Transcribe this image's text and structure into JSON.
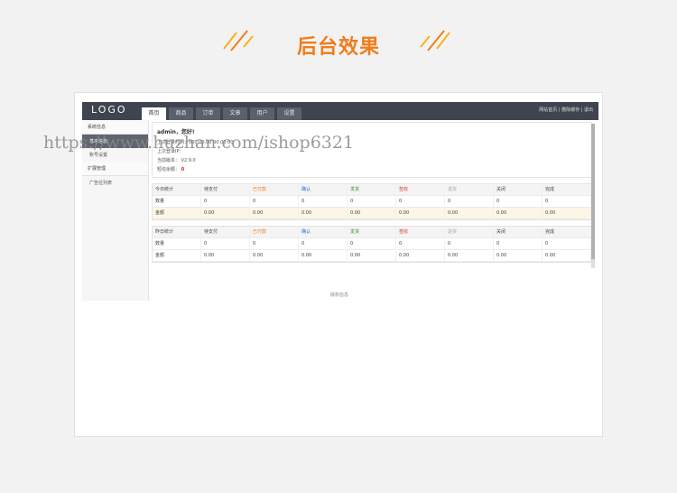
{
  "heading": "后台效果",
  "colors": {
    "accent": "#f07d1a",
    "topbar": "#3f4450",
    "highlight_row": "#fdf6e6"
  },
  "admin": {
    "logo": "LOGO",
    "nav": [
      "首页",
      "商品",
      "订单",
      "文章",
      "用户",
      "设置"
    ],
    "top_links": "网站首页 | 删除缓存 | 退出",
    "sidebar": {
      "group1": "系统信息",
      "item1": "基本信息",
      "item2": "账号设置",
      "group2": "扩展管理",
      "item3": "广告位列表"
    },
    "info": {
      "title": "admin，您好!",
      "line1": "上次登录时间：000.00.00 00:00:00",
      "line2": "上次登录IP：",
      "line3": "当前版本： V2.9.0",
      "line4_label": "短信余额：",
      "line4_value": "0"
    },
    "stats_today": {
      "headers": [
        "今日统计",
        "待支付",
        "已付款",
        "确认",
        "发货",
        "签收",
        "退货",
        "关闭",
        "完成"
      ],
      "rows": [
        [
          "数量",
          "0",
          "0",
          "0",
          "0",
          "0",
          "0",
          "0",
          "0"
        ],
        [
          "金额",
          "0.00",
          "0.00",
          "0.00",
          "0.00",
          "0.00",
          "0.00",
          "0.00",
          "0.00"
        ]
      ]
    },
    "stats_yesterday": {
      "headers": [
        "昨日统计",
        "待支付",
        "已付款",
        "确认",
        "发货",
        "签收",
        "退货",
        "关闭",
        "完成"
      ],
      "rows": [
        [
          "数量",
          "0",
          "0",
          "0",
          "0",
          "0",
          "0",
          "0",
          "0"
        ],
        [
          "金额",
          "0.00",
          "0.00",
          "0.00",
          "0.00",
          "0.00",
          "0.00",
          "0.00",
          "0.00"
        ]
      ]
    },
    "footer": "版权信息"
  },
  "watermark_url": "https://www.huzhan.com/ishop6321"
}
